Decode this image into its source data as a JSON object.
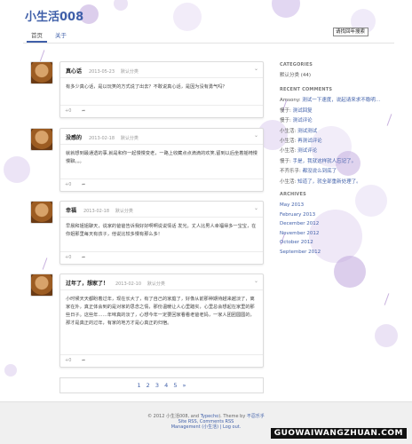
{
  "site": {
    "title": "小生活",
    "title_num": "008"
  },
  "nav": {
    "tabs": [
      "首页",
      "关于"
    ],
    "active": 0
  },
  "search": {
    "button_label": "请找回年搜索"
  },
  "posts": [
    {
      "title": "真心话",
      "date": "2013-05-23",
      "category": "默认分类",
      "body": "有多少真心话，是以玩笑的方式说了出去？不敢说真心话，是因为没有勇气吗？",
      "comments": "+0",
      "share_icon": "share-icon"
    },
    {
      "title": "没感的",
      "date": "2013-02-18",
      "category": "默认分类",
      "body": "就就想到最通透的事,就是和你一起慢慢变老，一路上收藏点点滴滴的欢笑,留到以后坐着摇椅慢慢聊。。。",
      "comments": "+0",
      "share_icon": "share-icon"
    },
    {
      "title": "幸福",
      "date": "2013-02-18",
      "category": "默认分类",
      "body": "早晨和姐姐聊天，说家的爸爸告诉我好好啊啊说说情话 发光。丈人比男人幸福得多一宝宝，在你姐那里每天有孩子，他说比较多慢有那么多！",
      "comments": "+0",
      "share_icon": "share-icon"
    },
    {
      "title": "过年了，想家了！",
      "date": "2013-02-10",
      "category": "默认分类",
      "body": "小时候天天都盼着过年，现在长大了，有了自己的家庭了，好像从前那种期待越来越淡了，离家在外，真正体会到的是对家的思念之情，那份温暖让人心里踏实，心里总会想起在家里的那些日子。这些年……年味真的淡了，心想今年一定要回家看看老爸老妈，一家人团团圆圆的，那才是真正的过年，有家的地方才是心真正的归宿。",
      "comments": "+0",
      "share_icon": "share-icon"
    }
  ],
  "pagination": {
    "pages": [
      "1",
      "2",
      "3",
      "4",
      "5"
    ],
    "next": "»"
  },
  "sidebar": {
    "categories_heading": "CATEGORIES",
    "categories": [
      {
        "name": "默认分类",
        "count": "(44)"
      }
    ],
    "recent_comments_heading": "RECENT COMMENTS",
    "recent_comments": [
      {
        "author": "Amsony:",
        "text": "测试一下速度，说起请来求不稳明…"
      },
      {
        "author": "慢于:",
        "text": "测试回复"
      },
      {
        "author": "慢于:",
        "text": "测试评论"
      },
      {
        "author": "小生活:",
        "text": "测试测试"
      },
      {
        "author": "小生活:",
        "text": "再测试评论"
      },
      {
        "author": "小生活:",
        "text": "测试评论"
      },
      {
        "author": "慢于:",
        "text": "手是，我就这样就人忘记了。"
      },
      {
        "author": "不齐乐乎:",
        "text": "都没说么到底了"
      },
      {
        "author": "小生活:",
        "text": "知道了，就全部重新处理了。"
      }
    ],
    "archives_heading": "ARCHIVES",
    "archives": [
      "May 2013",
      "February 2013",
      "December 2012",
      "November 2012",
      "October 2012",
      "September 2012"
    ]
  },
  "footer": {
    "copyright_prefix": "© 2012 小生活008, and",
    "powered_by": "Typecho",
    "theme_label": "). Theme by",
    "theme_author": "不忍乐乎",
    "line2": "Site RSS, Comments RSS",
    "line3": "Management (小生活) | Log out."
  },
  "watermark": "GUOWAIWANGZHUAN.COM",
  "colors": {
    "accent": "#3f5fa9",
    "bubble": "#c8b3e0",
    "footer_bg": "#f0f0f0"
  }
}
